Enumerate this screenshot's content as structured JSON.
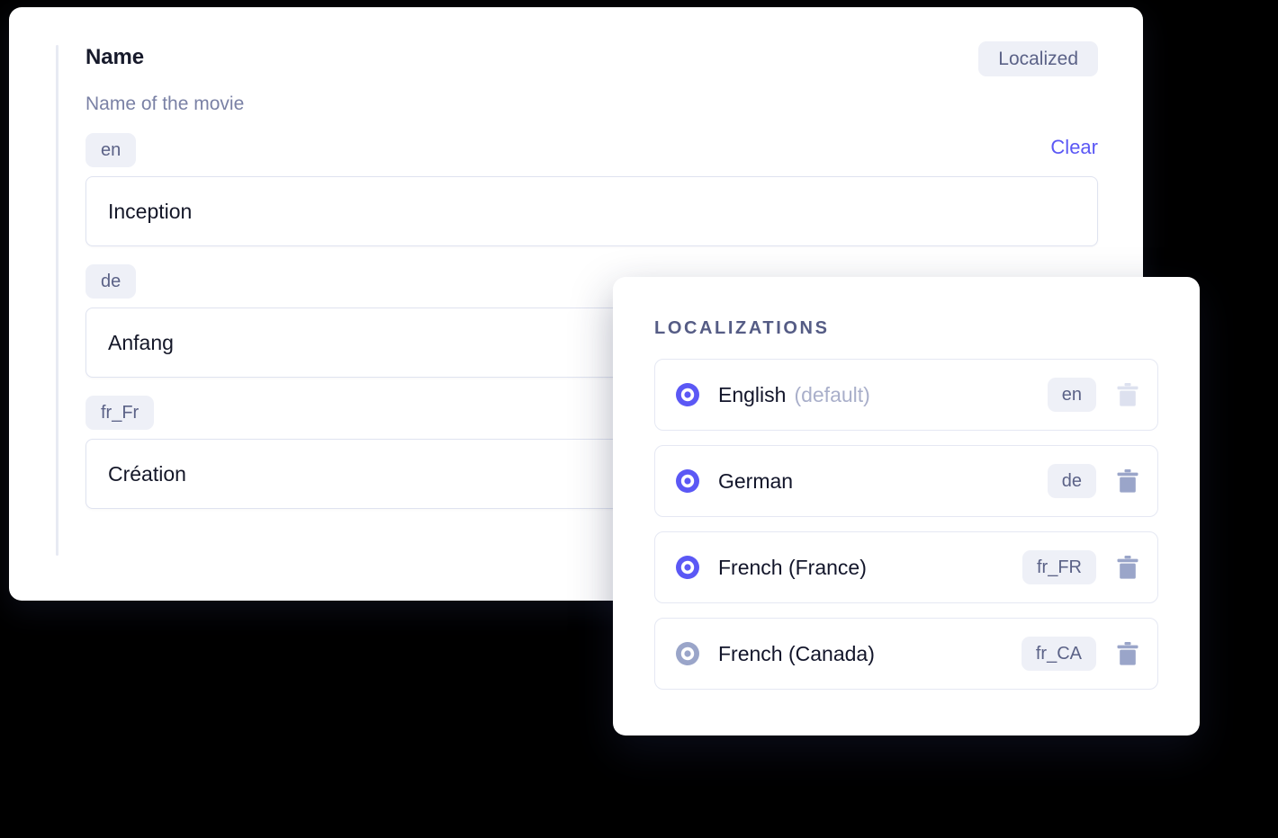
{
  "form": {
    "title": "Name",
    "localized_badge": "Localized",
    "description": "Name of the movie",
    "clear_label": "Clear",
    "fields": [
      {
        "locale_tag": "en",
        "value": "Inception"
      },
      {
        "locale_tag": "de",
        "value": "Anfang"
      },
      {
        "locale_tag": "fr_Fr",
        "value": "Création"
      }
    ]
  },
  "localizations_panel": {
    "title": "LOCALIZATIONS",
    "items": [
      {
        "name": "English",
        "suffix": "(default)",
        "code": "en",
        "selected": true,
        "radio_color": "#5b58f5",
        "delete_enabled": false
      },
      {
        "name": "German",
        "suffix": "",
        "code": "de",
        "selected": true,
        "radio_color": "#5b58f5",
        "delete_enabled": true
      },
      {
        "name": "French (France)",
        "suffix": "",
        "code": "fr_FR",
        "selected": true,
        "radio_color": "#5b58f5",
        "delete_enabled": true
      },
      {
        "name": "French (Canada)",
        "suffix": "",
        "code": "fr_CA",
        "selected": false,
        "radio_color": "#9aa5c9",
        "delete_enabled": true
      }
    ]
  },
  "colors": {
    "background": "#000000",
    "card": "#ffffff",
    "accent_purple": "#5b58f5",
    "tag_bg": "#eef0f7",
    "tag_text": "#5b6287",
    "muted_text": "#7a81a5",
    "heading": "#171a2b",
    "border": "#dfe3f0",
    "trash_enabled": "#9aa5c9",
    "trash_disabled": "#dde1ef",
    "accent_bar": "#e7eaf3"
  }
}
